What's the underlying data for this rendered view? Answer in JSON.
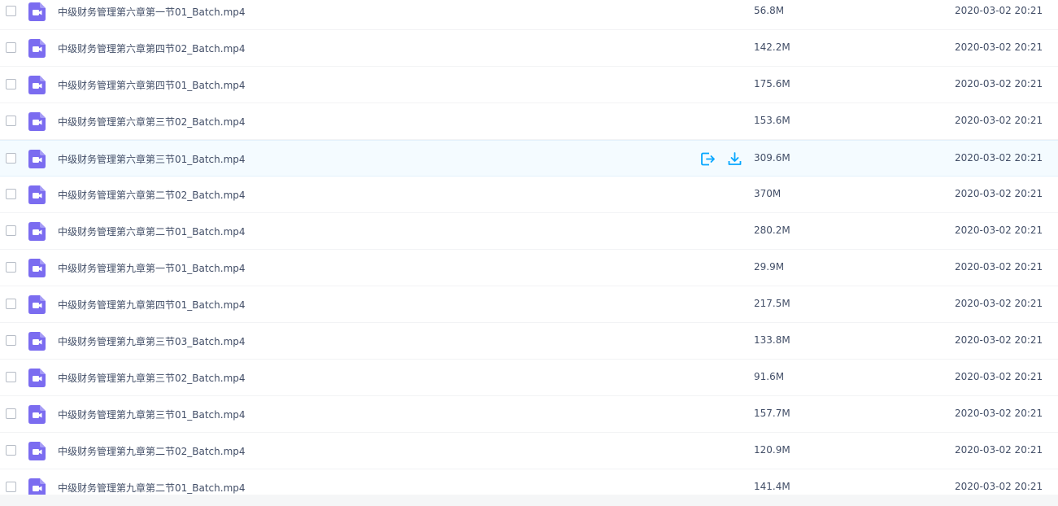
{
  "accent_color": "#06a7ff",
  "video_icon_color": "#7b6cf0",
  "files": [
    {
      "name": "中级财务管理第六章第一节01_Batch.mp4",
      "size": "56.8M",
      "date": "2020-03-02 20:21"
    },
    {
      "name": "中级财务管理第六章第四节02_Batch.mp4",
      "size": "142.2M",
      "date": "2020-03-02 20:21"
    },
    {
      "name": "中级财务管理第六章第四节01_Batch.mp4",
      "size": "175.6M",
      "date": "2020-03-02 20:21"
    },
    {
      "name": "中级财务管理第六章第三节02_Batch.mp4",
      "size": "153.6M",
      "date": "2020-03-02 20:21"
    },
    {
      "name": "中级财务管理第六章第三节01_Batch.mp4",
      "size": "309.6M",
      "date": "2020-03-02 20:21",
      "hovered": true,
      "actions": [
        "share-icon",
        "download-icon"
      ]
    },
    {
      "name": "中级财务管理第六章第二节02_Batch.mp4",
      "size": "370M",
      "date": "2020-03-02 20:21"
    },
    {
      "name": "中级财务管理第六章第二节01_Batch.mp4",
      "size": "280.2M",
      "date": "2020-03-02 20:21"
    },
    {
      "name": "中级财务管理第九章第一节01_Batch.mp4",
      "size": "29.9M",
      "date": "2020-03-02 20:21"
    },
    {
      "name": "中级财务管理第九章第四节01_Batch.mp4",
      "size": "217.5M",
      "date": "2020-03-02 20:21"
    },
    {
      "name": "中级财务管理第九章第三节03_Batch.mp4",
      "size": "133.8M",
      "date": "2020-03-02 20:21"
    },
    {
      "name": "中级财务管理第九章第三节02_Batch.mp4",
      "size": "91.6M",
      "date": "2020-03-02 20:21"
    },
    {
      "name": "中级财务管理第九章第三节01_Batch.mp4",
      "size": "157.7M",
      "date": "2020-03-02 20:21"
    },
    {
      "name": "中级财务管理第九章第二节02_Batch.mp4",
      "size": "120.9M",
      "date": "2020-03-02 20:21"
    },
    {
      "name": "中级财务管理第九章第二节01_Batch.mp4",
      "size": "141.4M",
      "date": "2020-03-02 20:21"
    }
  ]
}
